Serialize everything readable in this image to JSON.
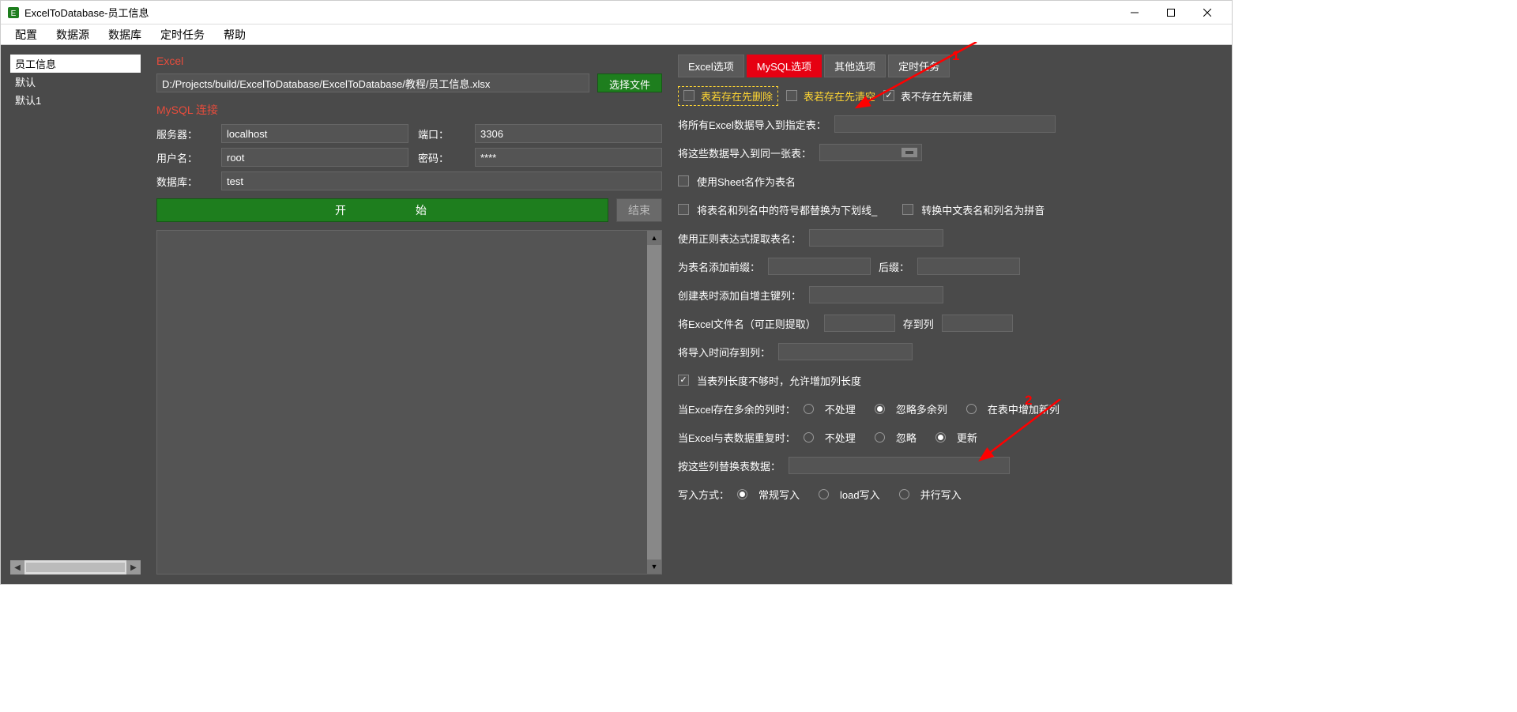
{
  "window": {
    "title": "ExcelToDatabase-员工信息"
  },
  "menubar": [
    "配置",
    "数据源",
    "数据库",
    "定时任务",
    "帮助"
  ],
  "sidebar": {
    "items": [
      "员工信息",
      "默认",
      "默认1"
    ],
    "selectedIndex": 0
  },
  "center": {
    "excelLabel": "Excel",
    "excelPath": "D:/Projects/build/ExcelToDatabase/ExcelToDatabase/教程/员工信息.xlsx",
    "chooseFile": "选择文件",
    "mysqlLabel": "MySQL 连接",
    "fields": {
      "serverLabel": "服务器：",
      "server": "localhost",
      "portLabel": "端口：",
      "port": "3306",
      "userLabel": "用户名：",
      "user": "root",
      "passwordLabel": "密码：",
      "password": "****",
      "dbLabel": "数据库：",
      "db": "test"
    },
    "startBtn": "开　　始",
    "endBtn": "结束"
  },
  "tabs": [
    "Excel选项",
    "MySQL选项",
    "其他选项",
    "定时任务"
  ],
  "activeTab": 1,
  "options": {
    "dropIfExists": "表若存在先删除",
    "truncateIfExists": "表若存在先清空",
    "createIfNotExists": "表不存在先新建",
    "importAllToTable": "将所有Excel数据导入到指定表：",
    "importTheseToSameTable": "将这些数据导入到同一张表：",
    "useSheetNameAsTable": "使用Sheet名作为表名",
    "replaceSymbolsUnderscore": "将表名和列名中的符号都替换为下划线_",
    "convertCnToPinyin": "转换中文表名和列名为拼音",
    "regexExtractTableName": "使用正则表达式提取表名：",
    "tablePrefix": "为表名添加前缀：",
    "tableSuffix": "后缀：",
    "addAutoPk": "创建表时添加自增主键列：",
    "saveFilenameToCol": "将Excel文件名（可正则提取）",
    "saveToCol": "存到列",
    "saveImportTimeToCol": "将导入时间存到列：",
    "allowExtendColLen": "当表列长度不够时，允许增加列长度",
    "whenExtraCols": "当Excel存在多余的列时：",
    "extraColsOpts": [
      "不处理",
      "忽略多余列",
      "在表中增加新列"
    ],
    "whenDuplicate": "当Excel与表数据重复时：",
    "duplicateOpts": [
      "不处理",
      "忽略",
      "更新"
    ],
    "replaceByCols": "按这些列替换表数据：",
    "writeMode": "写入方式：",
    "writeModeOpts": [
      "常规写入",
      "load写入",
      "并行写入"
    ]
  },
  "annotations": {
    "one": "1",
    "two": "2"
  }
}
